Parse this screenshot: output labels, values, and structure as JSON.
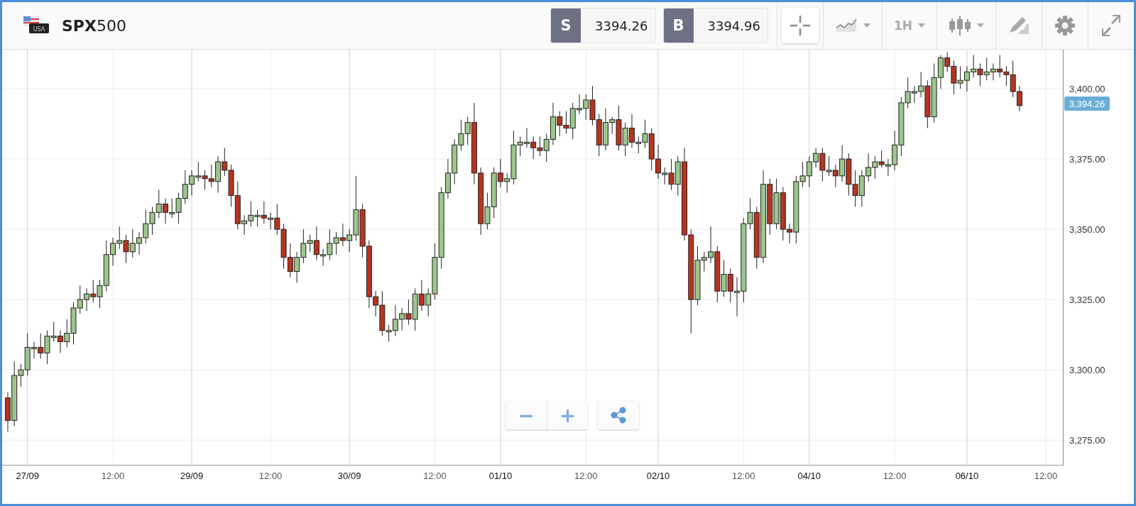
{
  "instrument": {
    "flag_label": "USA",
    "title": "**SPX**500"
  },
  "quotes": [
    {
      "letter": "S",
      "price": "3394.26"
    },
    {
      "letter": "B",
      "price": "3394.96"
    }
  ],
  "toolbar": [
    {
      "kind": "crosshair",
      "selected": true
    },
    {
      "kind": "chart-type",
      "selected": false
    },
    {
      "kind": "timeframe",
      "label": "1H",
      "selected": false
    },
    {
      "kind": "candles",
      "selected": false
    },
    {
      "kind": "draw",
      "selected": false
    },
    {
      "kind": "settings",
      "selected": false
    },
    {
      "kind": "fullscreen",
      "selected": false
    }
  ],
  "chart": {
    "chart_data": {
      "type": "candlestick",
      "categories": [
        null,
        null,
        null,
        "27/09",
        null,
        null,
        null,
        null,
        null,
        null,
        null,
        null,
        null,
        null,
        null,
        null,
        "12:00",
        null,
        null,
        null,
        null,
        null,
        null,
        null,
        null,
        null,
        null,
        null,
        "29/09",
        null,
        null,
        null,
        null,
        null,
        null,
        null,
        null,
        null,
        null,
        null,
        "12:00",
        null,
        null,
        null,
        null,
        null,
        null,
        null,
        null,
        null,
        null,
        null,
        "30/09",
        null,
        null,
        null,
        null,
        null,
        null,
        null,
        null,
        null,
        null,
        null,
        null,
        "12:00",
        null,
        null,
        null,
        null,
        null,
        null,
        null,
        null,
        null,
        "01/10",
        null,
        null,
        null,
        null,
        null,
        null,
        null,
        null,
        null,
        null,
        null,
        null,
        "12:00",
        null,
        null,
        null,
        null,
        null,
        null,
        null,
        null,
        null,
        null,
        "02/10",
        null,
        null,
        null,
        null,
        null,
        null,
        null,
        null,
        null,
        null,
        null,
        null,
        "12:00",
        null,
        null,
        null,
        null,
        null,
        null,
        null,
        null,
        null,
        "04/10",
        null,
        null,
        null,
        null,
        null,
        null,
        null,
        null,
        null,
        null,
        null,
        null,
        "12:00",
        null,
        null,
        null,
        null,
        null,
        null,
        null,
        null,
        null,
        null,
        "06/10",
        null,
        null,
        null,
        null,
        null,
        null,
        null,
        null,
        null,
        null,
        null,
        "12:00"
      ],
      "ohlc": [
        [
          3290,
          3292,
          3278,
          3282
        ],
        [
          3282,
          3303,
          3280,
          3298
        ],
        [
          3298,
          3302,
          3294,
          3300
        ],
        [
          3300,
          3313,
          3298,
          3308
        ],
        [
          3308,
          3310,
          3304,
          3308
        ],
        [
          3308,
          3313,
          3304,
          3306
        ],
        [
          3306,
          3314,
          3302,
          3312
        ],
        [
          3312,
          3317,
          3310,
          3312
        ],
        [
          3312,
          3314,
          3306,
          3310
        ],
        [
          3310,
          3318,
          3308,
          3313
        ],
        [
          3313,
          3324,
          3309,
          3322
        ],
        [
          3322,
          3330,
          3320,
          3325
        ],
        [
          3325,
          3329,
          3321,
          3327
        ],
        [
          3327,
          3332,
          3324,
          3326
        ],
        [
          3326,
          3332,
          3322,
          3330
        ],
        [
          3330,
          3346,
          3328,
          3341
        ],
        [
          3341,
          3347,
          3337,
          3345
        ],
        [
          3345,
          3351,
          3343,
          3346
        ],
        [
          3346,
          3348,
          3338,
          3342
        ],
        [
          3342,
          3350,
          3340,
          3345
        ],
        [
          3345,
          3349,
          3341,
          3347
        ],
        [
          3347,
          3357,
          3345,
          3352
        ],
        [
          3352,
          3358,
          3348,
          3356
        ],
        [
          3356,
          3364,
          3354,
          3359
        ],
        [
          3359,
          3361,
          3352,
          3356
        ],
        [
          3356,
          3361,
          3354,
          3356
        ],
        [
          3356,
          3363,
          3352,
          3361
        ],
        [
          3361,
          3371,
          3359,
          3366
        ],
        [
          3366,
          3371,
          3362,
          3369
        ],
        [
          3369,
          3374,
          3367,
          3369
        ],
        [
          3369,
          3371,
          3364,
          3368
        ],
        [
          3368,
          3373,
          3365,
          3367
        ],
        [
          3367,
          3376,
          3363,
          3374
        ],
        [
          3374,
          3379,
          3369,
          3371
        ],
        [
          3371,
          3373,
          3358,
          3362
        ],
        [
          3362,
          3367,
          3350,
          3352
        ],
        [
          3352,
          3355,
          3348,
          3353
        ],
        [
          3353,
          3360,
          3351,
          3355
        ],
        [
          3355,
          3357,
          3351,
          3355
        ],
        [
          3355,
          3360,
          3352,
          3354
        ],
        [
          3354,
          3356,
          3350,
          3354
        ],
        [
          3354,
          3359,
          3348,
          3350
        ],
        [
          3350,
          3352,
          3336,
          3340
        ],
        [
          3340,
          3345,
          3333,
          3335
        ],
        [
          3335,
          3342,
          3331,
          3340
        ],
        [
          3340,
          3350,
          3338,
          3345
        ],
        [
          3345,
          3348,
          3342,
          3346
        ],
        [
          3346,
          3351,
          3339,
          3341
        ],
        [
          3341,
          3343,
          3337,
          3341
        ],
        [
          3341,
          3350,
          3339,
          3345
        ],
        [
          3345,
          3349,
          3341,
          3347
        ],
        [
          3347,
          3352,
          3344,
          3346
        ],
        [
          3346,
          3350,
          3342,
          3348
        ],
        [
          3348,
          3369,
          3346,
          3357
        ],
        [
          3357,
          3359,
          3340,
          3344
        ],
        [
          3344,
          3346,
          3322,
          3326
        ],
        [
          3326,
          3328,
          3319,
          3323
        ],
        [
          3323,
          3328,
          3312,
          3314
        ],
        [
          3314,
          3316,
          3310,
          3314
        ],
        [
          3314,
          3323,
          3312,
          3318
        ],
        [
          3318,
          3322,
          3314,
          3320
        ],
        [
          3320,
          3325,
          3316,
          3318
        ],
        [
          3318,
          3329,
          3314,
          3327
        ],
        [
          3327,
          3332,
          3321,
          3323
        ],
        [
          3323,
          3329,
          3319,
          3327
        ],
        [
          3327,
          3345,
          3325,
          3340
        ],
        [
          3340,
          3365,
          3336,
          3363
        ],
        [
          3363,
          3375,
          3361,
          3370
        ],
        [
          3370,
          3382,
          3366,
          3380
        ],
        [
          3380,
          3389,
          3378,
          3384
        ],
        [
          3384,
          3390,
          3380,
          3388
        ],
        [
          3388,
          3395,
          3366,
          3370
        ],
        [
          3370,
          3372,
          3348,
          3352
        ],
        [
          3352,
          3363,
          3350,
          3358
        ],
        [
          3358,
          3372,
          3354,
          3370
        ],
        [
          3370,
          3375,
          3365,
          3367
        ],
        [
          3367,
          3370,
          3363,
          3368
        ],
        [
          3368,
          3385,
          3366,
          3380
        ],
        [
          3380,
          3383,
          3376,
          3381
        ],
        [
          3381,
          3386,
          3379,
          3381
        ],
        [
          3381,
          3383,
          3375,
          3379
        ],
        [
          3379,
          3383,
          3376,
          3378
        ],
        [
          3378,
          3384,
          3374,
          3382
        ],
        [
          3382,
          3395,
          3380,
          3390
        ],
        [
          3390,
          3392,
          3383,
          3387
        ],
        [
          3387,
          3392,
          3384,
          3386
        ],
        [
          3386,
          3395,
          3382,
          3393
        ],
        [
          3393,
          3398,
          3391,
          3393
        ],
        [
          3393,
          3398,
          3389,
          3396
        ],
        [
          3396,
          3401,
          3387,
          3389
        ],
        [
          3389,
          3391,
          3376,
          3380
        ],
        [
          3380,
          3393,
          3378,
          3388
        ],
        [
          3388,
          3390,
          3384,
          3389
        ],
        [
          3389,
          3394,
          3378,
          3380
        ],
        [
          3380,
          3388,
          3376,
          3386
        ],
        [
          3386,
          3391,
          3379,
          3381
        ],
        [
          3381,
          3383,
          3377,
          3381
        ],
        [
          3381,
          3389,
          3379,
          3384
        ],
        [
          3384,
          3386,
          3371,
          3375
        ],
        [
          3375,
          3380,
          3368,
          3370
        ],
        [
          3370,
          3372,
          3366,
          3370
        ],
        [
          3370,
          3375,
          3364,
          3366
        ],
        [
          3366,
          3376,
          3362,
          3374
        ],
        [
          3374,
          3379,
          3346,
          3348
        ],
        [
          3348,
          3350,
          3313,
          3325
        ],
        [
          3325,
          3344,
          3323,
          3339
        ],
        [
          3339,
          3342,
          3335,
          3340
        ],
        [
          3340,
          3351,
          3338,
          3342
        ],
        [
          3342,
          3344,
          3324,
          3328
        ],
        [
          3328,
          3339,
          3326,
          3334
        ],
        [
          3334,
          3336,
          3324,
          3328
        ],
        [
          3328,
          3333,
          3319,
          3328
        ],
        [
          3328,
          3354,
          3324,
          3352
        ],
        [
          3352,
          3361,
          3350,
          3356
        ],
        [
          3356,
          3358,
          3336,
          3340
        ],
        [
          3340,
          3371,
          3338,
          3366
        ],
        [
          3366,
          3368,
          3348,
          3352
        ],
        [
          3352,
          3368,
          3350,
          3363
        ],
        [
          3363,
          3365,
          3346,
          3350
        ],
        [
          3350,
          3352,
          3345,
          3349
        ],
        [
          3349,
          3369,
          3345,
          3367
        ],
        [
          3367,
          3374,
          3365,
          3369
        ],
        [
          3369,
          3376,
          3365,
          3374
        ],
        [
          3374,
          3379,
          3372,
          3377
        ],
        [
          3377,
          3379,
          3367,
          3371
        ],
        [
          3371,
          3376,
          3369,
          3371
        ],
        [
          3371,
          3373,
          3365,
          3369
        ],
        [
          3369,
          3380,
          3367,
          3375
        ],
        [
          3375,
          3377,
          3362,
          3366
        ],
        [
          3366,
          3371,
          3358,
          3362
        ],
        [
          3362,
          3371,
          3358,
          3369
        ],
        [
          3369,
          3377,
          3367,
          3372
        ],
        [
          3372,
          3376,
          3368,
          3374
        ],
        [
          3374,
          3378,
          3372,
          3373
        ],
        [
          3373,
          3375,
          3369,
          3373
        ],
        [
          3373,
          3385,
          3371,
          3380
        ],
        [
          3380,
          3397,
          3376,
          3395
        ],
        [
          3395,
          3404,
          3393,
          3399
        ],
        [
          3399,
          3401,
          3395,
          3399
        ],
        [
          3399,
          3406,
          3397,
          3401
        ],
        [
          3401,
          3403,
          3386,
          3390
        ],
        [
          3390,
          3409,
          3388,
          3404
        ],
        [
          3404,
          3412,
          3400,
          3411
        ],
        [
          3411,
          3413,
          3406,
          3408
        ],
        [
          3408,
          3410,
          3398,
          3402
        ],
        [
          3402,
          3408,
          3400,
          3403
        ],
        [
          3403,
          3408,
          3399,
          3406
        ],
        [
          3406,
          3412,
          3404,
          3407
        ],
        [
          3407,
          3409,
          3401,
          3405
        ],
        [
          3405,
          3411,
          3403,
          3406
        ],
        [
          3406,
          3409,
          3403,
          3407
        ],
        [
          3407,
          3412,
          3404,
          3406
        ],
        [
          3406,
          3408,
          3401,
          3405
        ],
        [
          3405,
          3410,
          3397,
          3399
        ],
        [
          3399,
          3401,
          3392,
          3394
        ],
        null,
        null,
        null,
        null
      ],
      "ylim": [
        3266.2,
        3413.9
      ],
      "grid": true,
      "yticks": [
        {
          "value": 3400,
          "label": "3,400.00"
        },
        {
          "value": 3375,
          "label": "3,375.00"
        },
        {
          "value": 3350,
          "label": "3,350.00"
        },
        {
          "value": 3325,
          "label": "3,325.00"
        },
        {
          "value": 3300,
          "label": "3,300.00"
        },
        {
          "value": 3275,
          "label": "3,275.00"
        }
      ]
    },
    "last_price": "3,394.26",
    "zoom_out": "−",
    "zoom_in": "+"
  }
}
